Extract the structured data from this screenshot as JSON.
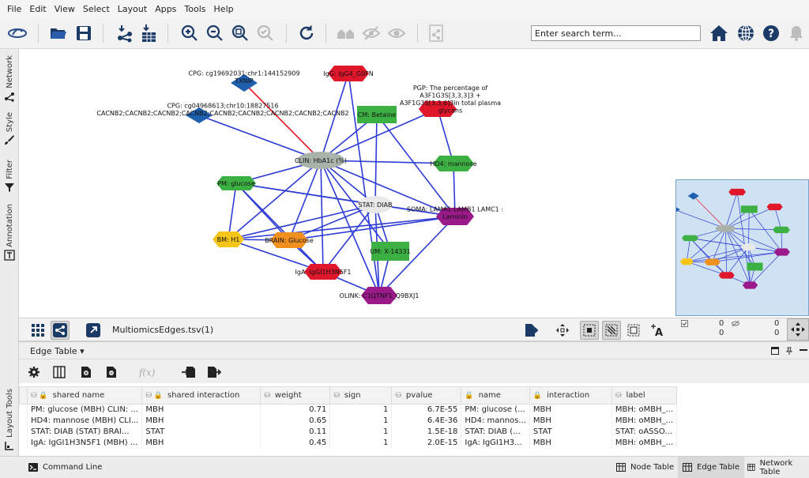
{
  "menu": [
    "File",
    "Edit",
    "View",
    "Select",
    "Layout",
    "Apps",
    "Tools",
    "Help"
  ],
  "search": {
    "placeholder": "Enter search term..."
  },
  "left_tabs": [
    "Network",
    "Style",
    "Filter",
    "Annotation"
  ],
  "bottom_left_tab": "Layout Tools",
  "network": {
    "nodes": [
      {
        "id": "cpg1",
        "label": "CPG: cg19692031;chr1:144152909\nTXNIP",
        "shape": "diamond",
        "color": "#1e5fae"
      },
      {
        "id": "cpg2",
        "label": "CPG: cg04968613;chr10:18827516\nCACNB2;CACNB2;CACNB2;CACNB2;CACNB2;CACNB2;CACNB2;CACNB2;CACNB2",
        "shape": "diamond",
        "color": "#1e5fae"
      },
      {
        "id": "igg",
        "label": "IgG: IgG4_G0FN",
        "shape": "hexagon",
        "color": "#e0162b"
      },
      {
        "id": "betaine",
        "label": "CM: Betaine",
        "shape": "rect",
        "color": "#3cb043"
      },
      {
        "id": "pgp",
        "label": "PGP: The percentage of\nA3F1G3S[3,3,3]3 +\nA3F1G3S[3,3,6]3in total plasma\nglycans",
        "shape": "hexagon",
        "color": "#e0162b"
      },
      {
        "id": "hba1c",
        "label": "CLIN: HbA1c (%)",
        "shape": "ellipse",
        "color": "#a9b3aa"
      },
      {
        "id": "mannose",
        "label": "HD4: mannose",
        "shape": "hexagon",
        "color": "#3cb043"
      },
      {
        "id": "glucose",
        "label": "PM: glucose",
        "shape": "hexagon",
        "color": "#3cb043"
      },
      {
        "id": "diab",
        "label": "STAT: DIAB",
        "shape": "ellipse",
        "color": "#e8e8e8"
      },
      {
        "id": "laminin",
        "label": "SOMA: LAMA1 LAMB1 LAMC1 :\nLaminin",
        "shape": "hexagon",
        "color": "#9b1a8a"
      },
      {
        "id": "h1",
        "label": "BM: H1",
        "shape": "hexagon",
        "color": "#f5c518"
      },
      {
        "id": "brainglucose",
        "label": "BRAIN: Glucose",
        "shape": "hexagon",
        "color": "#f0901e"
      },
      {
        "id": "x14331",
        "label": "UM: X-14331",
        "shape": "rect",
        "color": "#3cb043"
      },
      {
        "id": "iga",
        "label": "IgA: IgGI1H3N5F1",
        "shape": "hexagon",
        "color": "#e0162b"
      },
      {
        "id": "olink",
        "label": "OLINK: C1QTNF1_Q9BXJ1",
        "shape": "hexagon",
        "color": "#9b1a8a"
      }
    ],
    "edges": [
      [
        "hba1c",
        "cpg1",
        "#e8131c"
      ],
      [
        "hba1c",
        "cpg2",
        "#2e3cd6"
      ],
      [
        "hba1c",
        "igg",
        "#2e3cd6"
      ],
      [
        "hba1c",
        "betaine",
        "#2e3cd6"
      ],
      [
        "hba1c",
        "pgp",
        "#2e3cd6"
      ],
      [
        "hba1c",
        "mannose",
        "#2e3cd6"
      ],
      [
        "hba1c",
        "glucose",
        "#2e3cd6"
      ],
      [
        "hba1c",
        "diab",
        "#2e3cd6"
      ],
      [
        "hba1c",
        "laminin",
        "#2e3cd6"
      ],
      [
        "hba1c",
        "brainglucose",
        "#2e3cd6"
      ],
      [
        "hba1c",
        "x14331",
        "#2e3cd6"
      ],
      [
        "hba1c",
        "iga",
        "#2e3cd6"
      ],
      [
        "hba1c",
        "olink",
        "#2e3cd6"
      ],
      [
        "hba1c",
        "h1",
        "#2e3cd6"
      ],
      [
        "igg",
        "olink",
        "#2e3cd6"
      ],
      [
        "betaine",
        "laminin",
        "#2e3cd6"
      ],
      [
        "betaine",
        "diab",
        "#2e3cd6"
      ],
      [
        "pgp",
        "mannose",
        "#2e3cd6"
      ],
      [
        "mannose",
        "laminin",
        "#2e3cd6"
      ],
      [
        "glucose",
        "h1",
        "#2e3cd6"
      ],
      [
        "glucose",
        "brainglucose",
        "#2e3cd6"
      ],
      [
        "glucose",
        "diab",
        "#2e3cd6"
      ],
      [
        "glucose",
        "laminin",
        "#2e3cd6"
      ],
      [
        "glucose",
        "iga",
        "#2e3cd6"
      ],
      [
        "diab",
        "laminin",
        "#2e3cd6"
      ],
      [
        "diab",
        "h1",
        "#2e3cd6"
      ],
      [
        "diab",
        "brainglucose",
        "#2e3cd6"
      ],
      [
        "diab",
        "x14331",
        "#2e3cd6"
      ],
      [
        "diab",
        "iga",
        "#2e3cd6"
      ],
      [
        "diab",
        "olink",
        "#2e3cd6"
      ],
      [
        "laminin",
        "brainglucose",
        "#2e3cd6"
      ],
      [
        "laminin",
        "olink",
        "#2e3cd6"
      ],
      [
        "laminin",
        "h1",
        "#2e3cd6"
      ],
      [
        "brainglucose",
        "iga",
        "#2e3cd6"
      ],
      [
        "brainglucose",
        "h1",
        "#2e3cd6"
      ],
      [
        "x14331",
        "olink",
        "#2e3cd6"
      ],
      [
        "iga",
        "olink",
        "#2e3cd6"
      ],
      [
        "h1",
        "iga",
        "#2e3cd6"
      ]
    ]
  },
  "view": {
    "network_name": "MultiomicsEdges.tsv(1)"
  },
  "stats": {
    "selected_nodes": "0",
    "selected_edges": "0",
    "hidden_nodes": "0",
    "hidden_edges": "0"
  },
  "table_panel": {
    "title": "Edge Table",
    "menu_arrow": "▾",
    "columns": [
      "shared name",
      "shared interaction",
      "weight",
      "sign",
      "pvalue",
      "name",
      "interaction",
      "label"
    ],
    "rows": [
      [
        "PM: glucose (MBH) CLIN: ...",
        "MBH",
        "0.71",
        "1",
        "6.7E-55",
        "PM: glucose (...",
        "MBH",
        "MBH: oMBH_..."
      ],
      [
        "HD4: mannose (MBH) CLI...",
        "MBH",
        "0.65",
        "1",
        "6.4E-36",
        "HD4: mannos...",
        "MBH",
        "MBH: oMBH_..."
      ],
      [
        "STAT: DIAB (STAT) BRAI...",
        "STAT",
        "0.11",
        "1",
        "1.5E-18",
        "STAT: DIAB (...",
        "STAT",
        "STAT: oASSO..."
      ],
      [
        "IgA: IgGI1H3N5F1 (MBH) ...",
        "MBH",
        "0.45",
        "1",
        "2.0E-15",
        "IgA: IgGI1H3...",
        "MBH",
        "MBH: oMBH_..."
      ]
    ]
  },
  "status_bar": {
    "command_line": "Command Line",
    "tabs": [
      "Node Table",
      "Edge Table",
      "Network Table"
    ],
    "selected_tab": "Edge Table"
  }
}
